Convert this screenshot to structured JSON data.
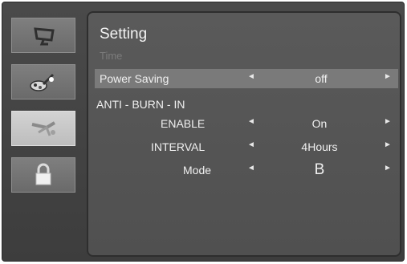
{
  "menu": {
    "title": "Setting",
    "subtitle": "Time",
    "power_saving": {
      "label": "Power Saving",
      "value": "off"
    },
    "section_title": "ANTI - BURN - IN",
    "enable": {
      "label": "ENABLE",
      "value": "On"
    },
    "interval": {
      "label": "INTERVAL",
      "value": "4Hours"
    },
    "mode": {
      "label": "Mode",
      "value": "B"
    }
  },
  "sidebar": {
    "items": [
      {
        "icon": "monitor-icon"
      },
      {
        "icon": "color-brush-icon"
      },
      {
        "icon": "tools-icon",
        "active": true
      },
      {
        "icon": "lock-icon"
      }
    ]
  },
  "arrows": {
    "left": "◄",
    "right": "►"
  },
  "colors": {
    "panel": "#555555",
    "highlight": "#7a7a7a",
    "text": "#f0f0f0"
  }
}
